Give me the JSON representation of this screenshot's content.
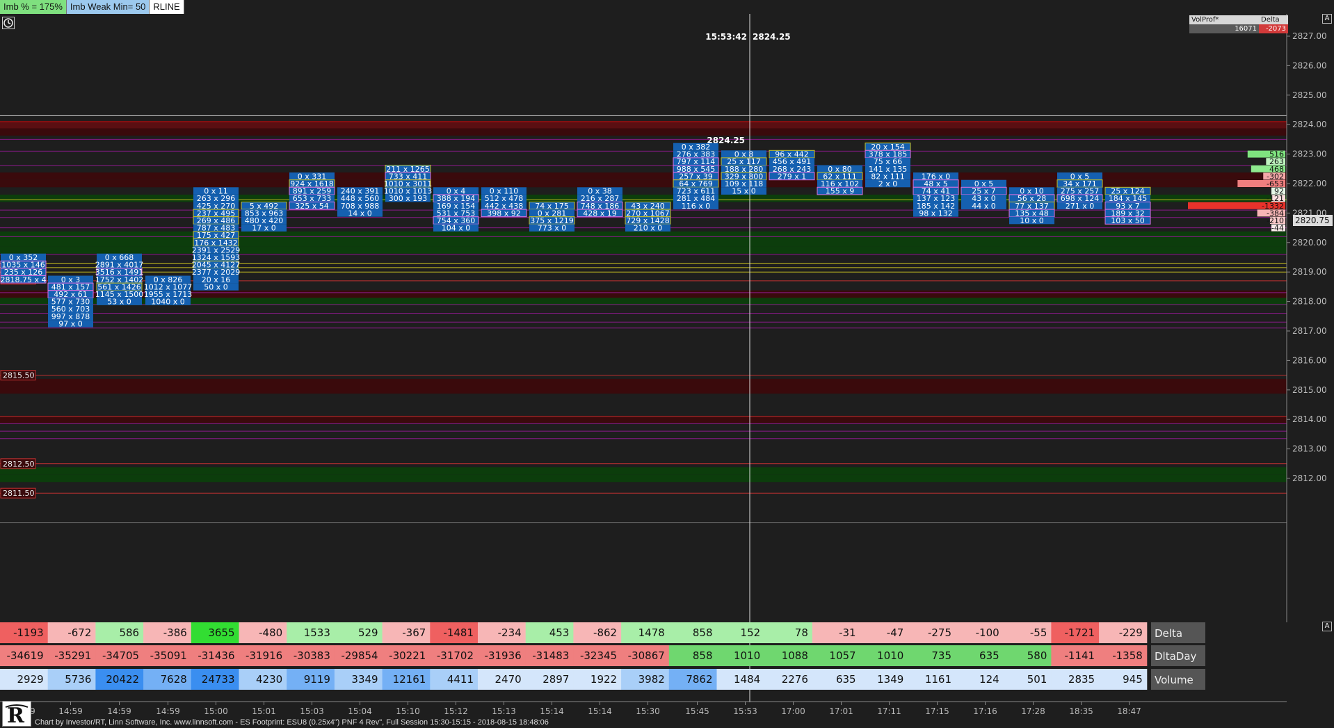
{
  "toolbar": {
    "items": [
      "Imb % = 175%",
      "Imb Weak Min= 50",
      "RLINE"
    ]
  },
  "cursor": {
    "time": "15:53:42",
    "price": "2824.25",
    "level_label": "2824.25"
  },
  "volprof": {
    "title": "VolProf*",
    "delta_header": "Delta",
    "volume": "16071",
    "delta": "-2073"
  },
  "price_axis": {
    "labels": [
      "2827.00",
      "2826.00",
      "2825.00",
      "2824.00",
      "2823.00",
      "2822.00",
      "2821.00",
      "2820.00",
      "2819.00",
      "2818.00",
      "2817.00",
      "2816.00",
      "2815.00",
      "2814.00",
      "2813.00",
      "2812.00"
    ],
    "current": "2820.75"
  },
  "level_tags": [
    "2818.75",
    "2815.50",
    "2812.50",
    "2811.50"
  ],
  "profile": [
    {
      "price": "2823.00",
      "value": "516",
      "color": "#7fe37f"
    },
    {
      "price": "2822.75",
      "value": "263",
      "color": "#bff3bf"
    },
    {
      "price": "2822.50",
      "value": "468",
      "color": "#8eea8e"
    },
    {
      "price": "2822.25",
      "value": "-302",
      "color": "#f4a8a8"
    },
    {
      "price": "2822.00",
      "value": "-653",
      "color": "#ef7f7f"
    },
    {
      "price": "2821.75",
      "value": "92",
      "color": "#e6f7e6"
    },
    {
      "price": "2821.50",
      "value": "-121",
      "color": "#fbdede"
    },
    {
      "price": "2821.25",
      "value": "-1332",
      "color": "#e8322b"
    },
    {
      "price": "2821.00",
      "value": "-384",
      "color": "#f6b5b5"
    },
    {
      "price": "2820.75",
      "value": "-210",
      "color": "#f8c8c8"
    },
    {
      "price": "2820.50",
      "value": "-44",
      "color": "#fbeaea"
    }
  ],
  "time_axis": [
    "14:59",
    "14:59",
    "14:59",
    "14:59",
    "15:00",
    "15:01",
    "15:03",
    "15:04",
    "15:10",
    "15:12",
    "15:13",
    "15:14",
    "15:14",
    "15:30",
    "15:45",
    "15:53",
    "17:00",
    "17:01",
    "17:11",
    "17:15",
    "17:16",
    "17:28",
    "18:35",
    "18:47"
  ],
  "stats": {
    "row_labels": [
      "Delta",
      "DltaDay",
      "Volume"
    ],
    "delta": [
      "-1193",
      "-672",
      "586",
      "-386",
      "3655",
      "-480",
      "1533",
      "529",
      "-367",
      "-1481",
      "-234",
      "453",
      "-862",
      "1478",
      "858",
      "152",
      "78",
      "-31",
      "-47",
      "-275",
      "-100",
      "-55",
      "-1721",
      "-229"
    ],
    "dltaday": [
      "-34619",
      "-35291",
      "-34705",
      "-35091",
      "-31436",
      "-31916",
      "-30383",
      "-29854",
      "-30221",
      "-31702",
      "-31936",
      "-31483",
      "-32345",
      "-30867",
      "858",
      "1010",
      "1088",
      "1057",
      "1010",
      "735",
      "635",
      "580",
      "-1141",
      "-1358"
    ],
    "volume": [
      "2929",
      "5736",
      "20422",
      "7628",
      "24733",
      "4230",
      "9119",
      "3349",
      "12161",
      "4411",
      "2470",
      "2897",
      "1922",
      "3982",
      "7862",
      "1484",
      "2276",
      "635",
      "1349",
      "1161",
      "124",
      "501",
      "2835",
      "945"
    ]
  },
  "footer": "Chart by Investor/RT, Linn Software, Inc. www.linnsoft.com - ES Footprint: ESU8 (0.25x4\") PNF 4 Rev\", Full Session 15:30-15:15 - 2018-08-15 18:48:06",
  "bars": [
    {
      "top": "2819.50",
      "cells": [
        "0 x 352",
        "1035 x 146",
        "235 x 126",
        "2818.75 x 4"
      ]
    },
    {
      "top": "2818.75",
      "cells": [
        "0 x 3",
        "481 x 157",
        "492 x 61",
        "577 x 730",
        "560 x 703",
        "997 x 878",
        "97 x 0"
      ]
    },
    {
      "top": "2819.50",
      "cells": [
        "0 x 668",
        "2891 x 4017",
        "3516 x 1491",
        "1752 x 1402",
        "561 x 1426",
        "1145 x 1500",
        "53 x 0"
      ]
    },
    {
      "top": "2818.75",
      "cells": [
        "0 x 826",
        "1012 x 1077",
        "1955 x 1713",
        "1040 x 0"
      ]
    },
    {
      "top": "2821.75",
      "cells": [
        "0 x 11",
        "263 x 296",
        "425 x 270",
        "237 x 495",
        "269 x 486",
        "787 x 483",
        "175 x 427",
        "176 x 1432",
        "2391 x 2529",
        "1324 x 1593",
        "2045 x 4127",
        "2377 x 2029",
        "20 x 16",
        "50 x 0"
      ]
    },
    {
      "top": "2821.25",
      "cells": [
        "5 x 492",
        "853 x 963",
        "480 x 420",
        "17 x 0"
      ]
    },
    {
      "top": "2822.25",
      "cells": [
        "0 x 331",
        "924 x 1618",
        "891 x 259",
        "653 x 733",
        "325 x 54"
      ]
    },
    {
      "top": "2821.75",
      "cells": [
        "240 x 391",
        "448 x 560",
        "708 x 988",
        "14 x 0"
      ]
    },
    {
      "top": "2822.50",
      "cells": [
        "211 x 1265",
        "733 x 411",
        "1010 x 3011",
        "1010 x 1013",
        "300 x 193"
      ]
    },
    {
      "top": "2821.75",
      "cells": [
        "0 x 4",
        "388 x 194",
        "169 x 154",
        "531 x 753",
        "754 x 360",
        "104 x 0"
      ]
    },
    {
      "top": "2821.75",
      "cells": [
        "0 x 110",
        "512 x 478",
        "442 x 438",
        "398 x 92"
      ]
    },
    {
      "top": "2821.25",
      "cells": [
        "74 x 175",
        "0 x 281",
        "375 x 1219",
        "773 x 0"
      ]
    },
    {
      "top": "2821.75",
      "cells": [
        "0 x 38",
        "216 x 287",
        "748 x 186",
        "428 x 19"
      ]
    },
    {
      "top": "2821.25",
      "cells": [
        "43 x 240",
        "270 x 1067",
        "729 x 1428",
        "210 x 0"
      ]
    },
    {
      "top": "2823.25",
      "cells": [
        "0 x 382",
        "276 x 383",
        "797 x 114",
        "988 x 545",
        "257 x 39",
        "64 x 769",
        "723 x 611",
        "281 x 484",
        "116 x 0"
      ]
    },
    {
      "top": "2823.00",
      "cells": [
        "0 x 8",
        "25 x 117",
        "188 x 280",
        "329 x 800",
        "109 x 118",
        "15 x 0"
      ]
    },
    {
      "top": "2823.00",
      "cells": [
        "96 x 442",
        "456 x 491",
        "268 x 243",
        "279 x 1"
      ]
    },
    {
      "top": "2822.50",
      "cells": [
        "0 x 80",
        "62 x 111",
        "116 x 102",
        "155 x 9"
      ]
    },
    {
      "top": "2823.25",
      "cells": [
        "20 x 154",
        "378 x 185",
        "75 x 66",
        "141 x 135",
        "82 x 111",
        "2 x 0"
      ]
    },
    {
      "top": "2822.25",
      "cells": [
        "176 x 0",
        "48 x 5",
        "74 x 41",
        "137 x 123",
        "185 x 142",
        "98 x 132"
      ]
    },
    {
      "top": "2822.00",
      "cells": [
        "0 x 5",
        "25 x 7",
        "43 x 0",
        "44 x 0"
      ]
    },
    {
      "top": "2821.75",
      "cells": [
        "0 x 10",
        "56 x 28",
        "77 x 137",
        "135 x 48",
        "10 x 0"
      ]
    },
    {
      "top": "2822.25",
      "cells": [
        "0 x 5",
        "34 x 171",
        "275 x 257",
        "698 x 124",
        "271 x 0"
      ]
    },
    {
      "top": "2821.75",
      "cells": [
        "25 x 124",
        "184 x 145",
        "93 x 7",
        "189 x 32",
        "103 x 50"
      ]
    }
  ]
}
